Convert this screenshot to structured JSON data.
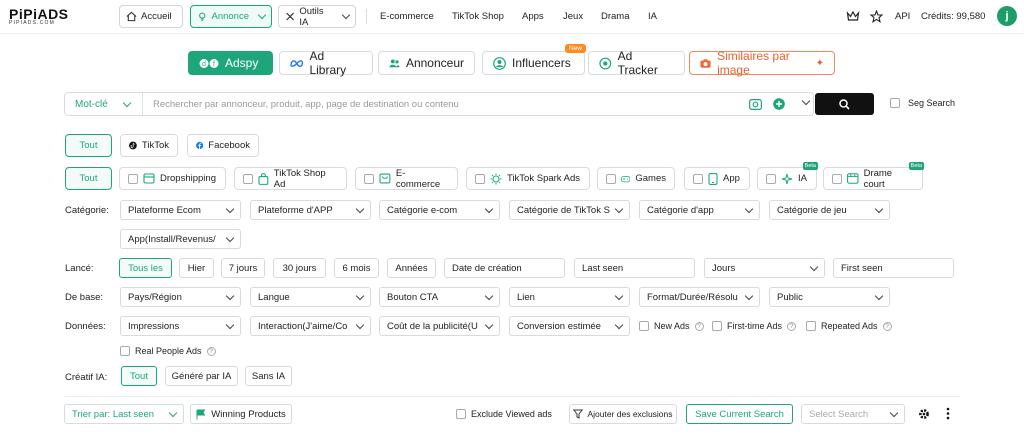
{
  "brand": {
    "name": "PiPiADS",
    "domain": "PIPIADS.COM"
  },
  "nav": {
    "home": "Accueil",
    "annonce": "Annonce",
    "outils": "Outils IA",
    "links": [
      "E-commerce",
      "TikTok Shop",
      "Apps",
      "Jeux",
      "Drama",
      "IA"
    ],
    "api": "API",
    "credits": "Crédits: 99,580",
    "avatar": "j"
  },
  "product_tabs": {
    "adspy": "Adspy",
    "ad_library": "Ad Library",
    "annonceur": "Annonceur",
    "influencers": "Influencers",
    "new_badge": "New",
    "ad_tracker": "Ad Tracker",
    "similaires": "Similaires par image"
  },
  "search": {
    "mode": "Mot-clé",
    "placeholder": "Rechercher par annonceur, produit, app, page de destination ou contenu",
    "seg": "Seg Search"
  },
  "platforms": {
    "all": "Tout",
    "tiktok": "TikTok",
    "facebook": "Facebook"
  },
  "types": {
    "all": "Tout",
    "dropshipping": "Dropshipping",
    "tiktok_shop": "TikTok Shop Ad",
    "ecommerce": "E-commerce",
    "spark": "TikTok Spark Ads",
    "games": "Games",
    "app": "App",
    "ia": "IA",
    "drame": "Drame court",
    "beta": "Beta"
  },
  "categorie": {
    "label": "Catégorie:",
    "items": [
      "Plateforme Ecom",
      "Plateforme d'APP",
      "Catégorie e-com",
      "Catégorie de TikTok S",
      "Catégorie d'app",
      "Catégorie de jeu",
      "App(Install/Revenus/"
    ]
  },
  "lance": {
    "label": "Lancé:",
    "items": [
      "Tous les",
      "Hier",
      "7 jours",
      "30 jours",
      "6 mois",
      "Années"
    ],
    "date_creation": "Date de création",
    "last_seen": "Last seen",
    "jours": "Jours",
    "first_seen": "First seen"
  },
  "base": {
    "label": "De base:",
    "items": [
      "Pays/Région",
      "Langue",
      "Bouton CTA",
      "Lien",
      "Format/Durée/Résolu",
      "Public"
    ]
  },
  "donnees": {
    "label": "Données:",
    "items": [
      "Impressions",
      "Interaction(J'aime/Co",
      "Coût de la publicité(U",
      "Conversion estimée"
    ],
    "new_ads": "New Ads",
    "first_time": "First-time Ads",
    "repeated": "Repeated Ads",
    "real_people": "Real People Ads"
  },
  "creatif": {
    "label": "Créatif IA:",
    "items": [
      "Tout",
      "Généré par IA",
      "Sans IA"
    ]
  },
  "bottom": {
    "sort": "Trier par: Last seen",
    "winning": "Winning Products",
    "exclude": "Exclude Viewed ads",
    "add_excl": "Ajouter des exclusions",
    "save": "Save Current Search",
    "select": "Select Search"
  },
  "colors": {
    "accent": "#1ea67a",
    "orange": "#e8622f",
    "badge": "#ff8a1f"
  }
}
